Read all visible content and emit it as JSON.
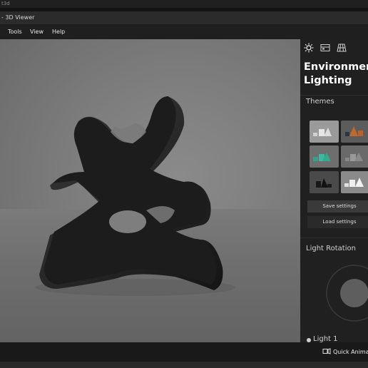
{
  "app_tag": "t3d",
  "window": {
    "title": "- 3D Viewer"
  },
  "menu": {
    "items": [
      "Tools",
      "View",
      "Help"
    ]
  },
  "panel": {
    "tabs": [
      "sun-icon",
      "environment-icon",
      "grid-icon"
    ],
    "title": "Environment &\nLighting",
    "themes_label": "Themes",
    "save_label": "Save settings",
    "load_label": "Load settings",
    "light_rotation_label": "Light Rotation",
    "light1_label": "Light 1"
  },
  "status": {
    "quick_animation_label": "Quick Animation"
  }
}
